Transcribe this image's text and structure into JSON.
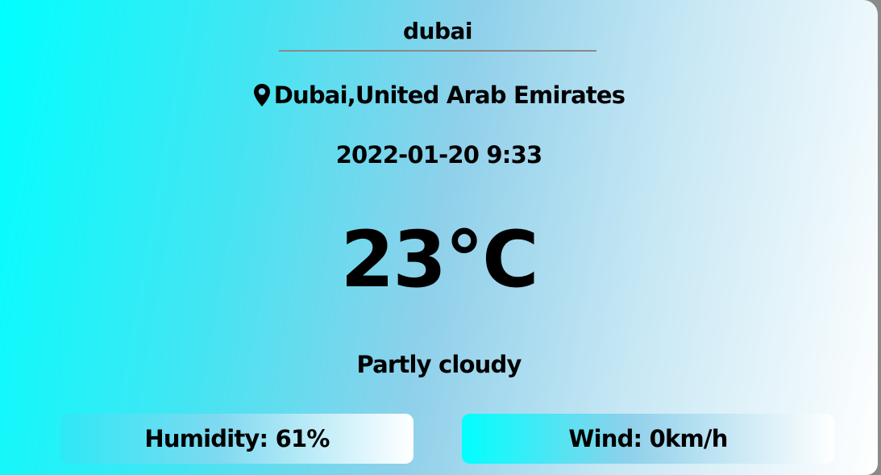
{
  "search": {
    "value": "dubai"
  },
  "location": {
    "icon": "map-pin-icon",
    "text": "Dubai,United Arab Emirates"
  },
  "datetime": "2022-01-20 9:33",
  "temperature": "23°C",
  "condition": "Partly cloudy",
  "stats": {
    "humidity": "Humidity: 61%",
    "wind": "Wind: 0km/h"
  },
  "colors": {
    "gradient_start": "#00ffff",
    "gradient_mid": "#8fd0ea",
    "gradient_end": "#ffffff",
    "text": "#000000",
    "underline": "#8a8a8a"
  }
}
